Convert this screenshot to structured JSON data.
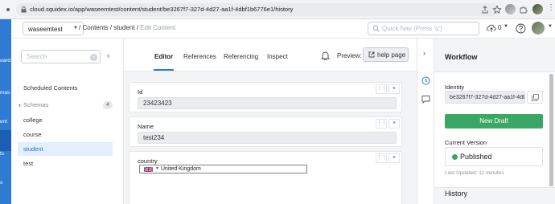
{
  "browser": {
    "url": "cloud.squidex.io/app/waseemtest/content/student/be3267f7-327d-4d27-aa1f-4dbf1b6776e1/history"
  },
  "nav_rail": {
    "fragments": [
      "oard",
      "mas",
      "ent",
      "ts",
      "s"
    ]
  },
  "header": {
    "app_name": "waseemtest",
    "breadcrumb": {
      "sep1": "/",
      "contents": "Contents",
      "sep2": "/",
      "schema": "student",
      "sep3": "/",
      "current": "Edit Content"
    },
    "quick_nav_placeholder": "Quick Nav (Press 'q')",
    "upload_count": "0"
  },
  "sidebar": {
    "search_placeholder": "Search",
    "scheduled": "Scheduled Contents",
    "schemas_label": "Schemas",
    "schemas_count": "4",
    "items": [
      {
        "label": "college",
        "active": false
      },
      {
        "label": "course",
        "active": false
      },
      {
        "label": "student",
        "active": true
      },
      {
        "label": "test",
        "active": false
      }
    ]
  },
  "main": {
    "tabs": [
      {
        "label": "Editor",
        "active": true
      },
      {
        "label": "References",
        "active": false
      },
      {
        "label": "Referencing",
        "active": false
      },
      {
        "label": "Inspect",
        "active": false
      }
    ],
    "preview_label": "Preview:",
    "help_button": "help page",
    "fields": [
      {
        "label": "Id",
        "value": "23423423"
      },
      {
        "label": "Name",
        "value": "test234"
      }
    ],
    "country": {
      "label": "country",
      "value": "United Kingdom"
    }
  },
  "workflow": {
    "title": "Workflow",
    "identity_label": "Identity",
    "identity_value": "be3267f7-327d-4d27-aa1f-4dbf1b6776e1",
    "new_draft": "New Draft",
    "current_version_label": "Current Version",
    "status": "Published",
    "last_updated": "Last Updated: 11 minutes",
    "history_title": "History"
  },
  "colors": {
    "brand": "#2f7bd3",
    "success": "#3aa864"
  }
}
